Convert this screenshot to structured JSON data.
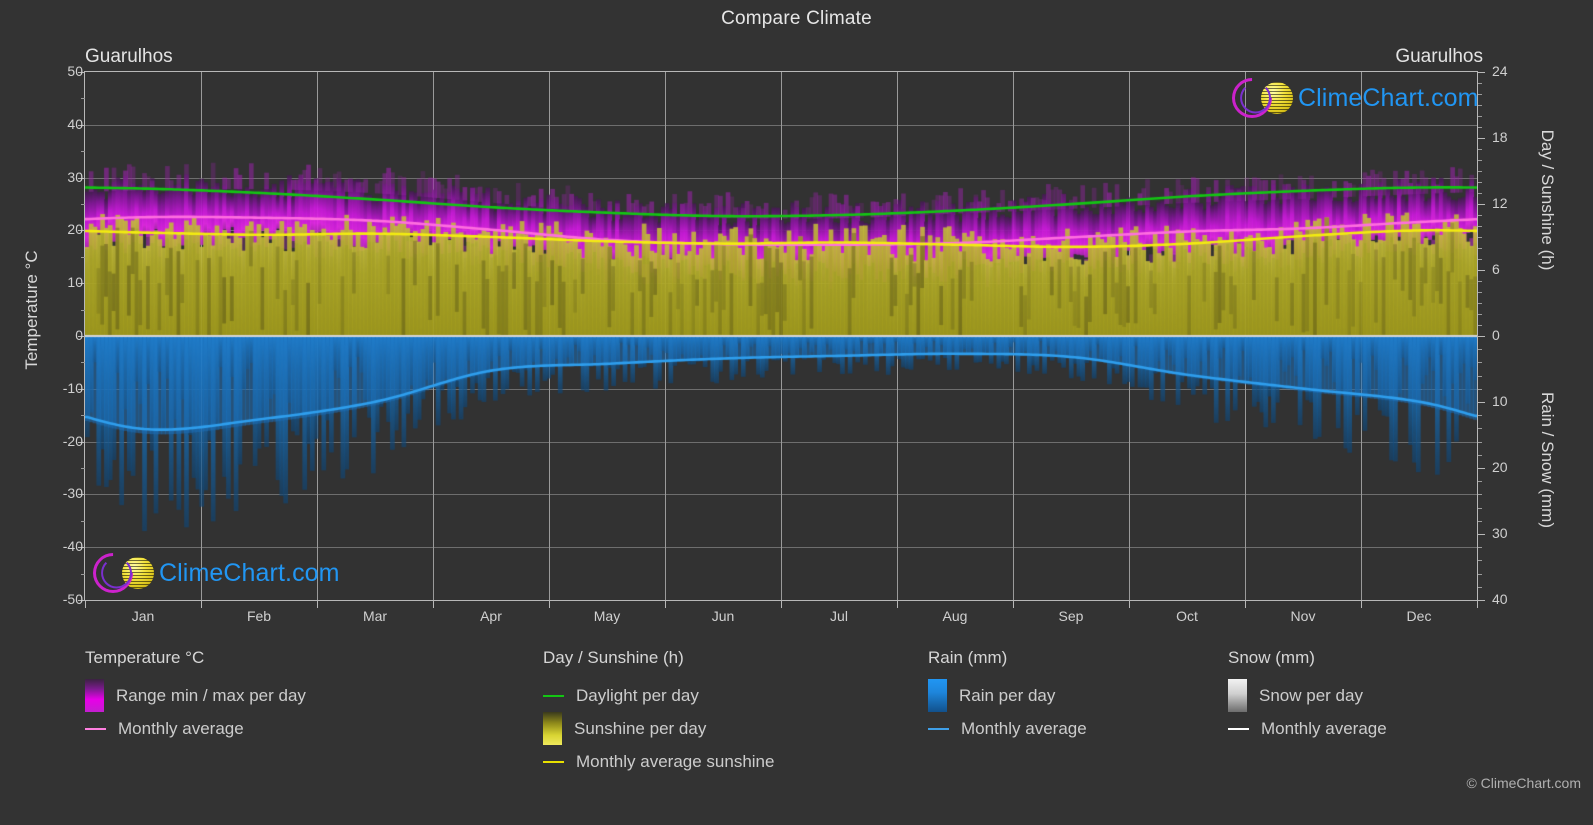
{
  "title": "Compare Climate",
  "city_left": "Guarulhos",
  "city_right": "Guarulhos",
  "copyright": "© ClimeChart.com",
  "watermark_text": "ClimeChart.com",
  "axes": {
    "left_label": "Temperature °C",
    "right_label_top": "Day / Sunshine (h)",
    "right_label_bottom": "Rain / Snow (mm)",
    "left_ticks": [
      "50",
      "40",
      "30",
      "20",
      "10",
      "0",
      "-10",
      "-20",
      "-30",
      "-40",
      "-50"
    ],
    "right_ticks_top": [
      "24",
      "18",
      "12",
      "6",
      "0"
    ],
    "right_ticks_bottom": [
      "10",
      "20",
      "30",
      "40"
    ],
    "x_ticks": [
      "Jan",
      "Feb",
      "Mar",
      "Apr",
      "May",
      "Jun",
      "Jul",
      "Aug",
      "Sep",
      "Oct",
      "Nov",
      "Dec"
    ]
  },
  "legend": {
    "temperature": {
      "title": "Temperature °C",
      "items": [
        {
          "label": "Range min / max per day",
          "marker": "gradient-swatch",
          "color": "#e800e8"
        },
        {
          "label": "Monthly average",
          "marker": "line",
          "color": "#ff7fe0"
        }
      ]
    },
    "daysunshine": {
      "title": "Day / Sunshine (h)",
      "items": [
        {
          "label": "Daylight per day",
          "marker": "line",
          "color": "#13c613"
        },
        {
          "label": "Sunshine per day",
          "marker": "gradient-swatch",
          "color": "#e8e834"
        },
        {
          "label": "Monthly average sunshine",
          "marker": "line",
          "color": "#e8e000"
        }
      ]
    },
    "rain": {
      "title": "Rain (mm)",
      "items": [
        {
          "label": "Rain per day",
          "marker": "gradient-swatch",
          "color": "#1884d8"
        },
        {
          "label": "Monthly average",
          "marker": "line",
          "color": "#3f9fe8"
        }
      ]
    },
    "snow": {
      "title": "Snow (mm)",
      "items": [
        {
          "label": "Snow per day",
          "marker": "gradient-swatch",
          "color": "#e8e8e8"
        },
        {
          "label": "Monthly average",
          "marker": "line",
          "color": "#ffffff"
        }
      ]
    }
  },
  "colors": {
    "background": "#333333",
    "plot_background": "#323232",
    "grid": "#6e6e6e",
    "axis": "#b8b8b8",
    "temp_range": "#e800e8",
    "temp_avg": "#ff7fe0",
    "daylight": "#13c613",
    "sunshine": "#b5b021",
    "sunshine_avg": "#f0e800",
    "rain": "#1a6fae",
    "rain_avg": "#3f9fe8",
    "logo_blue": "#2196f3",
    "logo_magenta": "#cc22cc"
  },
  "chart_data": {
    "type": "area",
    "title": "Compare Climate",
    "subtitle": "Guarulhos",
    "xlabel": "",
    "ylabel": "Temperature °C",
    "categories": [
      "Jan",
      "Feb",
      "Mar",
      "Apr",
      "May",
      "Jun",
      "Jul",
      "Aug",
      "Sep",
      "Oct",
      "Nov",
      "Dec"
    ],
    "axis_left": {
      "label": "Temperature °C",
      "min": -50,
      "max": 50,
      "step": 10
    },
    "axis_right_top": {
      "label": "Day / Sunshine (h)",
      "min": 0,
      "max": 24,
      "step": 6
    },
    "axis_right_bottom": {
      "label": "Rain / Snow (mm)",
      "min": 0,
      "max": 40,
      "step": 10
    },
    "grid": true,
    "legend_position": "bottom",
    "series": [
      {
        "name": "Monthly average",
        "unit": "°C",
        "axis": "left",
        "color": "#ff7fe0",
        "values": [
          22.5,
          22.4,
          21.8,
          20.1,
          18.2,
          17.4,
          17.3,
          17.6,
          18.7,
          19.8,
          20.4,
          21.6
        ]
      },
      {
        "name": "Range max per day",
        "unit": "°C",
        "axis": "left",
        "color": "#e800e8",
        "values": [
          28.0,
          28.2,
          27.4,
          25.6,
          23.7,
          22.8,
          22.7,
          23.6,
          24.5,
          25.6,
          26.4,
          27.3
        ]
      },
      {
        "name": "Range min per day",
        "unit": "°C",
        "axis": "left",
        "color": "#a000a0",
        "values": [
          18.4,
          18.4,
          17.8,
          16.1,
          13.6,
          12.4,
          12.0,
          12.4,
          13.9,
          15.4,
          16.2,
          17.6
        ]
      },
      {
        "name": "Daylight per day",
        "unit": "h",
        "axis": "right_top",
        "color": "#13c613",
        "values": [
          13.4,
          13.0,
          12.4,
          11.7,
          11.2,
          10.9,
          11.0,
          11.4,
          12.0,
          12.7,
          13.2,
          13.5
        ]
      },
      {
        "name": "Monthly average sunshine",
        "unit": "h",
        "axis": "right_top",
        "color": "#f0e800",
        "values": [
          9.4,
          9.2,
          9.3,
          9.0,
          8.6,
          8.4,
          8.5,
          8.3,
          8.1,
          8.4,
          9.1,
          9.6
        ]
      },
      {
        "name": "Rain monthly average",
        "unit": "mm",
        "axis": "right_bottom",
        "color": "#3f9fe8",
        "values": [
          14.1,
          12.6,
          9.9,
          5.2,
          4.2,
          3.4,
          3.0,
          2.7,
          3.2,
          5.9,
          8.0,
          10.0
        ]
      }
    ]
  }
}
